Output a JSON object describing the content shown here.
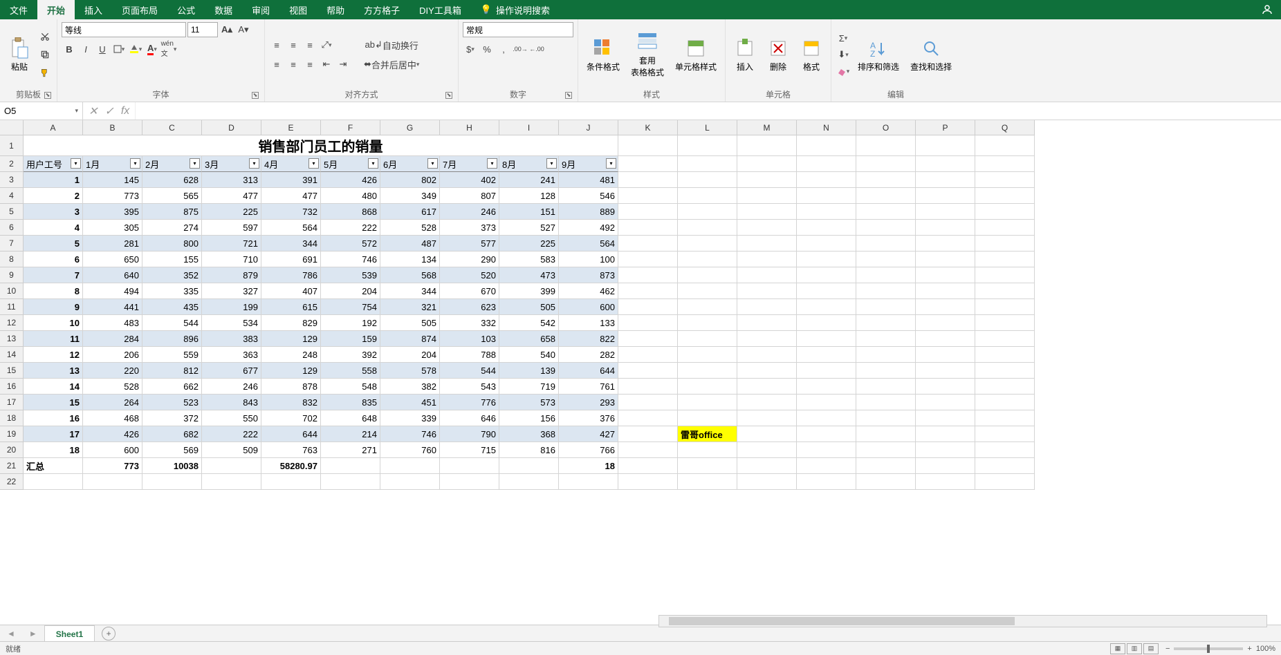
{
  "menu": {
    "tabs": [
      "文件",
      "开始",
      "插入",
      "页面布局",
      "公式",
      "数据",
      "审阅",
      "视图",
      "帮助",
      "方方格子",
      "DIY工具箱"
    ],
    "active_index": 1,
    "tell_me": "操作说明搜索"
  },
  "ribbon": {
    "clipboard": {
      "label": "剪贴板",
      "paste": "粘贴"
    },
    "font": {
      "label": "字体",
      "name": "等线",
      "size": "11",
      "bold": "B",
      "italic": "I",
      "underline": "U"
    },
    "alignment": {
      "label": "对齐方式",
      "wrap": "自动换行",
      "merge": "合并后居中"
    },
    "number": {
      "label": "数字",
      "format": "常规"
    },
    "styles": {
      "label": "样式",
      "cond": "条件格式",
      "table": "套用\n表格格式",
      "cell": "单元格样式"
    },
    "cells": {
      "label": "单元格",
      "insert": "插入",
      "delete": "删除",
      "format": "格式"
    },
    "editing": {
      "label": "编辑",
      "sort": "排序和筛选",
      "find": "查找和选择"
    }
  },
  "formula_bar": {
    "name_box": "O5",
    "formula": ""
  },
  "columns": [
    "A",
    "B",
    "C",
    "D",
    "E",
    "F",
    "G",
    "H",
    "I",
    "J",
    "K",
    "L",
    "M",
    "N",
    "O",
    "P",
    "Q"
  ],
  "row_numbers": [
    1,
    2,
    3,
    4,
    5,
    6,
    7,
    8,
    9,
    10,
    11,
    12,
    13,
    14,
    15,
    16,
    17,
    18,
    19,
    20,
    21,
    22
  ],
  "title_row": "销售部门员工的销量",
  "filter_headers": [
    "用户工号",
    "1月",
    "2月",
    "3月",
    "4月",
    "5月",
    "6月",
    "7月",
    "8月",
    "9月"
  ],
  "data_rows": [
    [
      1,
      145,
      628,
      313,
      391,
      426,
      802,
      402,
      241,
      481
    ],
    [
      2,
      773,
      565,
      477,
      477,
      480,
      349,
      807,
      128,
      546
    ],
    [
      3,
      395,
      875,
      225,
      732,
      868,
      617,
      246,
      151,
      889
    ],
    [
      4,
      305,
      274,
      597,
      564,
      222,
      528,
      373,
      527,
      492
    ],
    [
      5,
      281,
      800,
      721,
      344,
      572,
      487,
      577,
      225,
      564
    ],
    [
      6,
      650,
      155,
      710,
      691,
      746,
      134,
      290,
      583,
      100
    ],
    [
      7,
      640,
      352,
      879,
      786,
      539,
      568,
      520,
      473,
      873
    ],
    [
      8,
      494,
      335,
      327,
      407,
      204,
      344,
      670,
      399,
      462
    ],
    [
      9,
      441,
      435,
      199,
      615,
      754,
      321,
      623,
      505,
      600
    ],
    [
      10,
      483,
      544,
      534,
      829,
      192,
      505,
      332,
      542,
      133
    ],
    [
      11,
      284,
      896,
      383,
      129,
      159,
      874,
      103,
      658,
      822
    ],
    [
      12,
      206,
      559,
      363,
      248,
      392,
      204,
      788,
      540,
      282
    ],
    [
      13,
      220,
      812,
      677,
      129,
      558,
      578,
      544,
      139,
      644
    ],
    [
      14,
      528,
      662,
      246,
      878,
      548,
      382,
      543,
      719,
      761
    ],
    [
      15,
      264,
      523,
      843,
      832,
      835,
      451,
      776,
      573,
      293
    ],
    [
      16,
      468,
      372,
      550,
      702,
      648,
      339,
      646,
      156,
      376
    ],
    [
      17,
      426,
      682,
      222,
      644,
      214,
      746,
      790,
      368,
      427
    ],
    [
      18,
      600,
      569,
      509,
      763,
      271,
      760,
      715,
      816,
      766
    ]
  ],
  "summary_row": {
    "label": "汇总",
    "b": "773",
    "c": "10038",
    "e": "58280.97",
    "j": "18"
  },
  "annotation": "雷哥office",
  "sheet": {
    "name": "Sheet1"
  },
  "status": {
    "ready": "就绪",
    "zoom": "100%"
  }
}
